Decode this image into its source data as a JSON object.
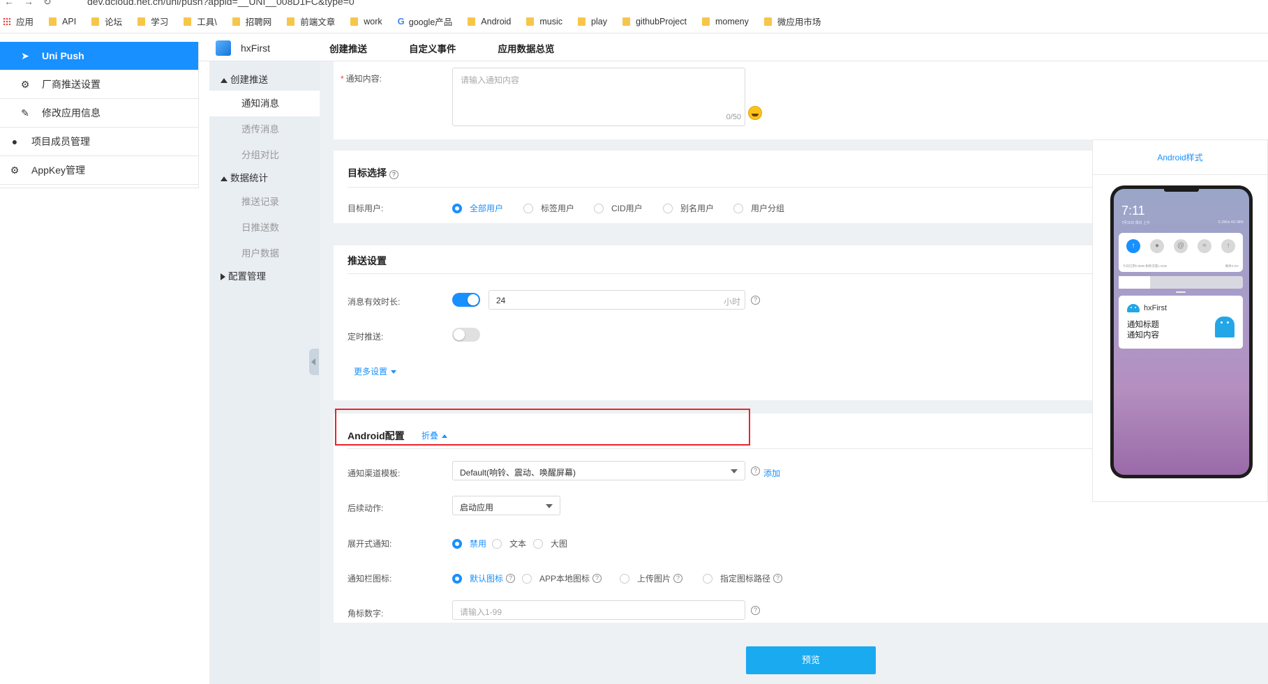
{
  "browser": {
    "url": "dev.dcloud.net.cn/uni/push?appid=__UNI__008D1FC&type=0",
    "bookmarks": [
      "应用",
      "API",
      "论坛",
      "学习",
      "工具\\",
      "招聘网",
      "前端文章",
      "work",
      "google产品",
      "Android",
      "music",
      "play",
      "githubProject",
      "momeny",
      "微应用市场"
    ]
  },
  "sidebar": {
    "items": [
      {
        "label": "Uni Push",
        "icon": "paper-plane-icon",
        "active": true
      },
      {
        "label": "厂商推送设置",
        "icon": "gear-icon"
      },
      {
        "label": "修改应用信息",
        "icon": "edit-icon"
      },
      {
        "label": "项目成员管理",
        "icon": "user-icon"
      },
      {
        "label": "AppKey管理",
        "icon": "gear-icon"
      }
    ]
  },
  "header": {
    "app_name": "hxFirst",
    "tabs": [
      "创建推送",
      "自定义事件",
      "应用数据总览"
    ]
  },
  "subnav": {
    "group1": "创建推送",
    "group1_items": [
      "通知消息",
      "透传消息",
      "分组对比"
    ],
    "group2": "数据统计",
    "group2_items": [
      "推送记录",
      "日推送数",
      "用户数据"
    ],
    "group3": "配置管理"
  },
  "content_section": {
    "label": "通知内容:",
    "placeholder": "请输入通知内容",
    "counter": "0/50"
  },
  "target_section": {
    "title": "目标选择",
    "label": "目标用户:",
    "options": [
      "全部用户",
      "标签用户",
      "CID用户",
      "别名用户",
      "用户分组"
    ],
    "selected": "全部用户"
  },
  "push_settings": {
    "title": "推送设置",
    "ttl_label": "消息有效时长:",
    "ttl_enabled": true,
    "ttl_value": "24",
    "ttl_unit": "小时",
    "schedule_label": "定时推送:",
    "schedule_enabled": false,
    "more_link": "更多设置"
  },
  "android_config": {
    "title": "Android配置",
    "collapse_link": "折叠",
    "channel_label": "通知渠道模板:",
    "channel_value": "Default(响铃、震动、唤醒屏幕)",
    "add_link": "添加",
    "action_label": "后续动作:",
    "action_value": "启动应用",
    "expand_label": "展开式通知:",
    "expand_options": [
      "禁用",
      "文本",
      "大图"
    ],
    "expand_selected": "禁用",
    "icon_label": "通知栏图标:",
    "icon_options": [
      "默认图标",
      "APP本地图标",
      "上传图片",
      "指定图标路径"
    ],
    "icon_selected": "默认图标",
    "badge_label": "角标数字:",
    "badge_placeholder": "请输入1-99"
  },
  "preview_button": "预览",
  "phone_preview": {
    "title": "Android样式",
    "time": "7:11",
    "date": "7月15日 周日 上午",
    "status": "0.15K/s 4G 98%",
    "data_usage": "今日已用0.8MB 剩余流量1.9GB",
    "storage": "剩余0.8%",
    "notif_app": "hxFirst",
    "notif_title": "通知标题",
    "notif_body": "通知内容"
  },
  "colors": {
    "primary": "#1890ff",
    "preview_button": "#1aaaf0",
    "highlight": "#e8232b",
    "subnav_bg": "#e9eef3",
    "content_bg": "#eef1f4"
  }
}
